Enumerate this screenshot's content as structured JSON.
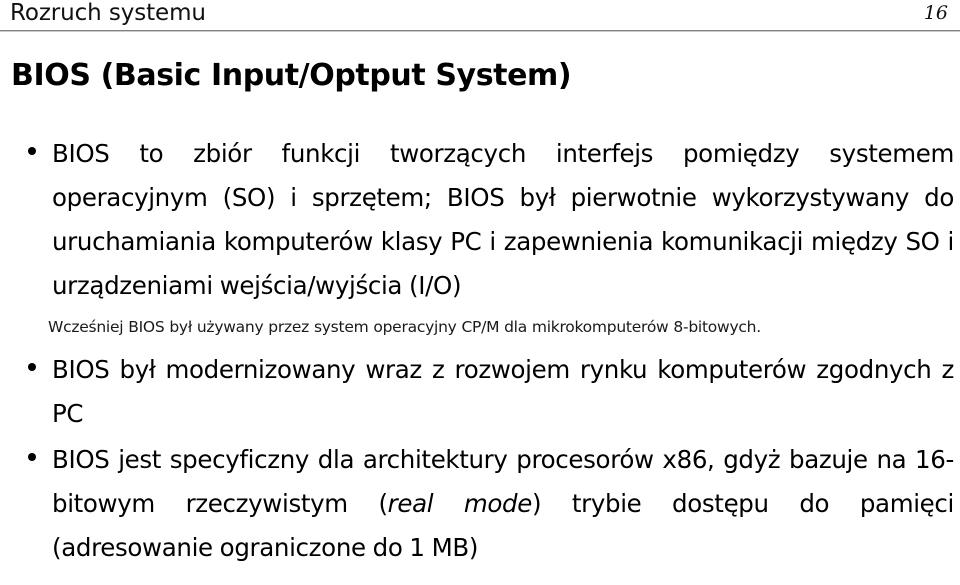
{
  "header": {
    "title": "Rozruch systemu",
    "page_number": "16"
  },
  "frame": {
    "title": "BIOS (Basic Input/Optput System)"
  },
  "content": {
    "bullets": [
      {
        "text": "BIOS to zbiór funkcji tworzących interfejs pomiędzy systemem operacyjnym (SO) i sprzętem; BIOS był pierwotnie wykorzystywany do uruchamiania komputerów klasy PC i zapewnienia komunikacji między SO i urządzeniami wejścia/wyjścia (I/O)"
      },
      {
        "text": "BIOS był modernizowany wraz z rozwojem rynku komputerów zgodnych z PC"
      },
      {
        "text_before_italic": "BIOS jest specyficzny dla architektury procesorów x86, gdyż bazuje na 16-bitowym rzeczywistym (",
        "italic": "real mode",
        "text_after_italic": ") trybie dostępu do pamięci (adresowanie ograniczone do 1 MB)"
      }
    ],
    "note": "Wcześniej BIOS był używany przez system operacyjny CP/M dla mikrokomputerów 8-bitowych."
  },
  "colors": {
    "text": "#000000",
    "rule": "#808080",
    "background": "#ffffff"
  }
}
